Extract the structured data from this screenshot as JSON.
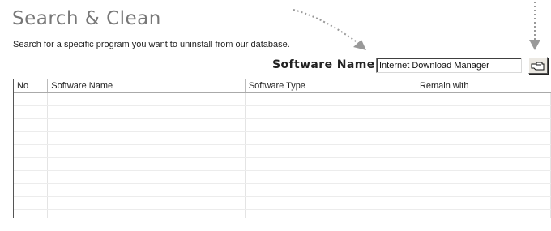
{
  "header": {
    "title": "Search & Clean",
    "description": "Search for a specific program you want to uninstall from our database."
  },
  "search": {
    "label": "Software Name:",
    "value": "Internet Download Manager",
    "button_icon": "pointing-hand-icon"
  },
  "table": {
    "columns": [
      "No",
      "Software Name",
      "Software Type",
      "Remain with",
      ""
    ],
    "rows": []
  },
  "colors": {
    "title": "#777777",
    "annotation_arrow": "#999999"
  }
}
